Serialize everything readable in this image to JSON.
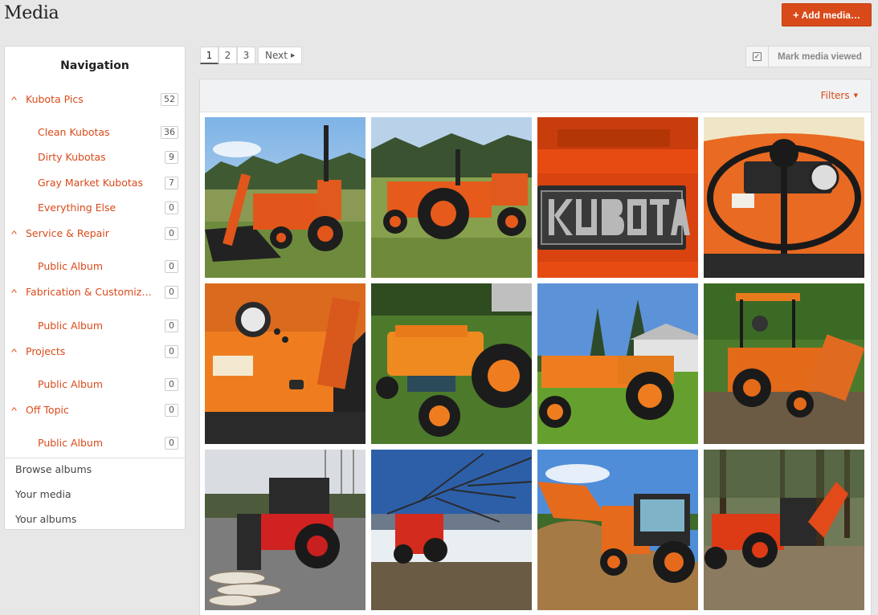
{
  "header": {
    "title": "Media",
    "add_media_label": "Add media…"
  },
  "sidebar": {
    "title": "Navigation",
    "categories": [
      {
        "label": "Kubota Pics",
        "count": "52",
        "albums": [
          {
            "label": "Clean Kubotas",
            "count": "36"
          },
          {
            "label": "Dirty Kubotas",
            "count": "9"
          },
          {
            "label": "Gray Market Kubotas",
            "count": "7"
          },
          {
            "label": "Everything Else",
            "count": "0"
          }
        ]
      },
      {
        "label": "Service & Repair",
        "count": "0",
        "albums": [
          {
            "label": "Public Album",
            "count": "0"
          }
        ]
      },
      {
        "label": "Fabrication & Customiz…",
        "count": "0",
        "albums": [
          {
            "label": "Public Album",
            "count": "0"
          }
        ]
      },
      {
        "label": "Projects",
        "count": "0",
        "albums": [
          {
            "label": "Public Album",
            "count": "0"
          }
        ]
      },
      {
        "label": "Off Topic",
        "count": "0",
        "albums": [
          {
            "label": "Public Album",
            "count": "0"
          }
        ]
      }
    ],
    "links": [
      "Browse albums",
      "Your media",
      "Your albums"
    ]
  },
  "pagination": {
    "pages": [
      "1",
      "2",
      "3"
    ],
    "current": "1",
    "next_label": "Next"
  },
  "mark_viewed_label": "Mark media viewed",
  "filters_label": "Filters",
  "media": [
    {
      "subject": "orange tractor with front loader in field",
      "scene": "field"
    },
    {
      "subject": "orange tractor with loader on grass",
      "scene": "field"
    },
    {
      "subject": "Kubota badge close-up",
      "scene": "closeup-badge"
    },
    {
      "subject": "tractor dashboard and steering wheel",
      "scene": "closeup-dash"
    },
    {
      "subject": "tractor dash side view close-up",
      "scene": "closeup-side"
    },
    {
      "subject": "small orange tractor on lawn",
      "scene": "lawn"
    },
    {
      "subject": "orange tractor beside house",
      "scene": "yard"
    },
    {
      "subject": "tractor with canopy and backhoe",
      "scene": "forest"
    },
    {
      "subject": "red tractor with log grapple",
      "scene": "snow-road"
    },
    {
      "subject": "tractor hauling branches on ice",
      "scene": "ice"
    },
    {
      "subject": "tractor with loader on dirt pile",
      "scene": "dirt"
    },
    {
      "subject": "tractor with backhoe in woods",
      "scene": "woods"
    }
  ],
  "colors": {
    "accent": "#d94a1a",
    "background": "#e7e7e7",
    "panel": "#ffffff"
  }
}
